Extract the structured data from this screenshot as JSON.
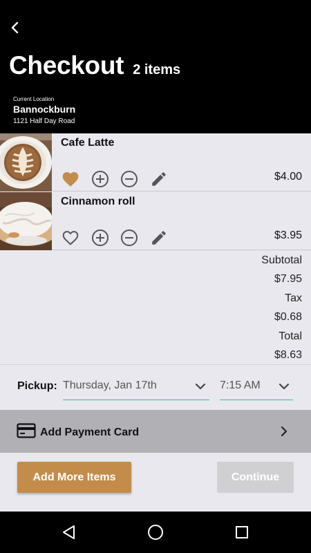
{
  "header": {
    "title": "Checkout",
    "item_count": "2 items",
    "location_caption": "Current Location",
    "location_name": "Bannockburn",
    "location_address": "1121 Half Day Road"
  },
  "items": [
    {
      "name": "Cafe Latte",
      "price": "$4.00",
      "favorited": true,
      "image": "latte-photo"
    },
    {
      "name": "Cinnamon roll",
      "price": "$3.95",
      "favorited": false,
      "image": "cinnamon-roll-photo"
    }
  ],
  "totals": {
    "subtotal_label": "Subtotal",
    "subtotal": "$7.95",
    "tax_label": "Tax",
    "tax": "$0.68",
    "total_label": "Total",
    "total": "$8.63"
  },
  "pickup": {
    "label": "Pickup:",
    "date": "Thursday, Jan 17th",
    "time": "7:15 AM"
  },
  "payment": {
    "label": "Add Payment Card"
  },
  "buttons": {
    "add_more": "Add More Items",
    "continue": "Continue"
  },
  "colors": {
    "accent": "#c38c4a",
    "underline": "#2bbfa4",
    "header_bg": "#000000",
    "page_bg": "#e9e8ee",
    "payment_bar": "#b1b0b4",
    "disabled_button": "#d0cfd2"
  },
  "icons": {
    "back": "chevron-left-icon",
    "favorite": "heart-icon",
    "increase": "plus-circle-icon",
    "decrease": "minus-circle-icon",
    "edit": "pencil-icon",
    "dropdown": "chevron-down-icon",
    "card": "credit-card-icon",
    "forward": "chevron-right-icon"
  }
}
